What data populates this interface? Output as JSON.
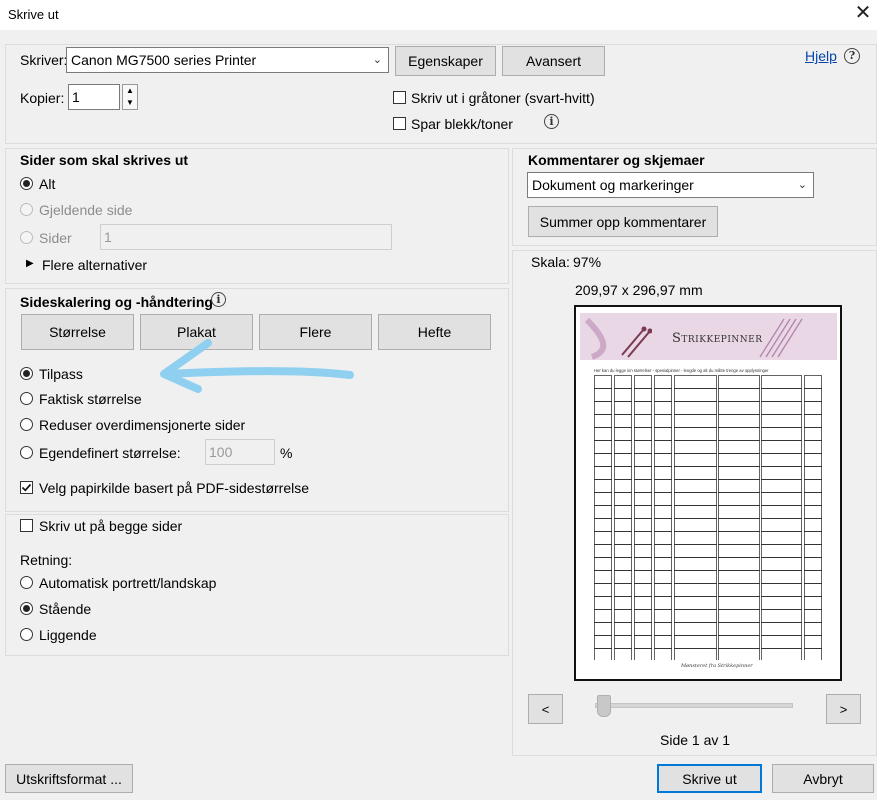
{
  "window": {
    "title": "Skrive ut",
    "close_glyph": "✕"
  },
  "printer": {
    "label": "Skriver:",
    "selected": "Canon MG7500 series Printer",
    "properties_button": "Egenskaper",
    "advanced_button": "Avansert",
    "help_link": "Hjelp",
    "copies_label": "Kopier:",
    "copies_value": "1",
    "grayscale_label": "Skriv ut i gråtoner (svart-hvitt)",
    "grayscale_checked": false,
    "save_ink_label": "Spar blekk/toner",
    "save_ink_checked": false
  },
  "pages": {
    "heading": "Sider som skal skrives ut",
    "options": [
      {
        "label": "Alt",
        "checked": true,
        "disabled": false
      },
      {
        "label": "Gjeldende side",
        "checked": false,
        "disabled": true
      },
      {
        "label": "Sider",
        "checked": false,
        "disabled": true
      }
    ],
    "pages_input_value": "1",
    "more_options": "Flere alternativer"
  },
  "sizing": {
    "heading": "Sideskalering og -håndtering",
    "tabs": [
      "Størrelse",
      "Plakat",
      "Flere",
      "Hefte"
    ],
    "options": [
      {
        "label": "Tilpass",
        "checked": true
      },
      {
        "label": "Faktisk størrelse",
        "checked": false
      },
      {
        "label": "Reduser overdimensjonerte sider",
        "checked": false
      },
      {
        "label": "Egendefinert størrelse:",
        "checked": false
      }
    ],
    "custom_value": "100",
    "custom_unit": "%",
    "paper_source_label": "Velg papirkilde basert på PDF-sidestørrelse",
    "paper_source_checked": true
  },
  "duplex": {
    "label": "Skriv ut på begge sider",
    "checked": false
  },
  "orientation": {
    "label": "Retning:",
    "options": [
      {
        "label": "Automatisk portrett/landskap",
        "checked": false
      },
      {
        "label": "Stående",
        "checked": true
      },
      {
        "label": "Liggende",
        "checked": false
      }
    ]
  },
  "comments": {
    "heading": "Kommentarer og skjemaer",
    "selected": "Dokument og markeringer",
    "summarize_button": "Summer opp kommentarer"
  },
  "preview": {
    "scale_label": "Skala:",
    "scale_value": "97%",
    "page_size": "209,97 x 296,97 mm",
    "doc_title": "Strikkepinner",
    "doc_subtitle": "Her kan du legge inn størrelser - spesialpinner - lengde og alt du måtte trenge av opplysninger",
    "doc_footer": "Mønsteret fra Strikkepinner",
    "page_indicator": "Side 1 av 1",
    "slider_position": 0,
    "prev_glyph": "<",
    "next_glyph": ">"
  },
  "footer": {
    "page_setup_button": "Utskriftsformat ...",
    "print_button": "Skrive ut",
    "cancel_button": "Avbryt"
  },
  "colors": {
    "accent": "#0078d7",
    "annotation_arrow": "#8fd0f0",
    "header_band": "#ead7e6"
  }
}
